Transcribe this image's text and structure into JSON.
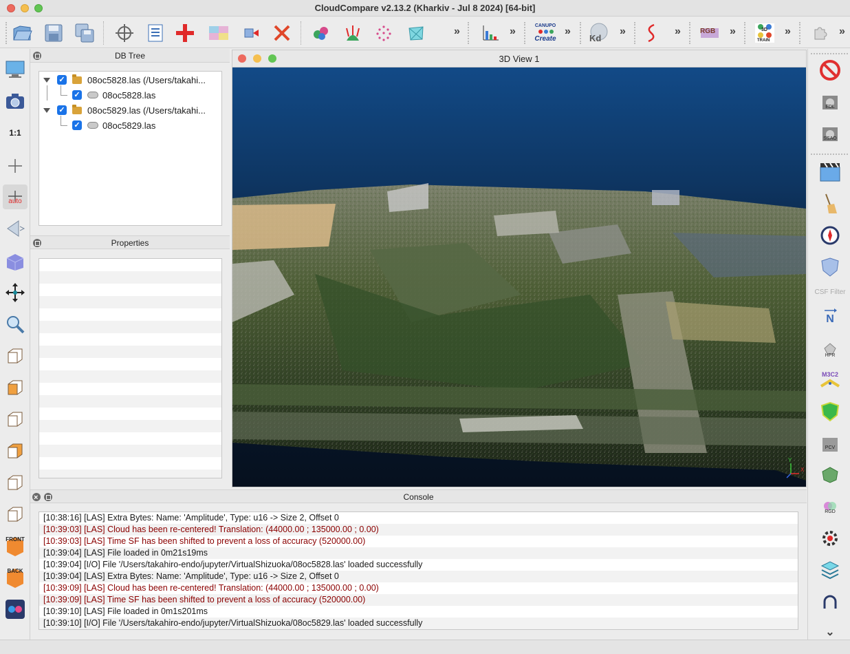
{
  "window": {
    "title": "CloudCompare v2.13.2 (Kharkiv - Jul  8 2024) [64-bit]"
  },
  "toolbar": {
    "icons": [
      "open-icon",
      "save-icon",
      "save-all-icon",
      "point-picking-icon",
      "list-icon",
      "add-cross-icon",
      "color-image-icon",
      "segment-icon",
      "delete-icon",
      "merge-icon",
      "normals-icon",
      "sample-icon",
      "mesh-icon",
      "histogram-icon",
      "canupo-create-icon",
      "kd-tree-icon",
      "curve-icon",
      "rgb-icon",
      "train-3d-icon",
      "plugin-icon"
    ],
    "canupo_top": "CANUPO",
    "canupo_bottom": "Create",
    "kd_label": "Kd",
    "rgb_label": "RGB",
    "train_label": "TRAIN",
    "train_3d": "3D"
  },
  "left_toolbar": {
    "one_to_one": "1:1",
    "auto_label": "auto",
    "front_label": "FRONT",
    "back_label": "BACK"
  },
  "right_toolbar": {
    "edl_label": "EDL",
    "ssao_label": "SSAO",
    "csf_label": "CSF Filter",
    "n_label": "N",
    "hpr_label": "HPR",
    "m3c2_label": "M3C2",
    "pcv_label": "PCV",
    "rgd_label": "RGD"
  },
  "db_tree": {
    "title": "DB Tree",
    "items": [
      {
        "label": "08oc5828.las (/Users/takahi...",
        "level": 0
      },
      {
        "label": "08oc5828.las",
        "level": 1
      },
      {
        "label": "08oc5829.las (/Users/takahi...",
        "level": 0
      },
      {
        "label": "08oc5829.las",
        "level": 1
      }
    ]
  },
  "properties": {
    "title": "Properties"
  },
  "view3d": {
    "title": "3D View 1",
    "axis_x": "X",
    "axis_y": "Y"
  },
  "console": {
    "title": "Console",
    "lines": [
      {
        "text": "[10:38:16] [LAS] Extra Bytes: Name: 'Amplitude', Type: u16 -> Size 2, Offset 0",
        "level": "info"
      },
      {
        "text": "[10:39:03] [LAS] Cloud has been re-centered! Translation: (44000.00 ; 135000.00 ; 0.00)",
        "level": "warn"
      },
      {
        "text": "[10:39:03] [LAS] Time SF has been shifted to prevent a loss of accuracy (520000.00)",
        "level": "warn"
      },
      {
        "text": "[10:39:04] [LAS] File loaded in 0m21s19ms",
        "level": "info"
      },
      {
        "text": "[10:39:04] [I/O] File '/Users/takahiro-endo/jupyter/VirtualShizuoka/08oc5828.las' loaded successfully",
        "level": "info"
      },
      {
        "text": "[10:39:04] [LAS] Extra Bytes: Name: 'Amplitude', Type: u16 -> Size 2, Offset 0",
        "level": "info"
      },
      {
        "text": "[10:39:09] [LAS] Cloud has been re-centered! Translation: (44000.00 ; 135000.00 ; 0.00)",
        "level": "warn"
      },
      {
        "text": "[10:39:09] [LAS] Time SF has been shifted to prevent a loss of accuracy (520000.00)",
        "level": "warn"
      },
      {
        "text": "[10:39:10] [LAS] File loaded in 0m1s201ms",
        "level": "info"
      },
      {
        "text": "[10:39:10] [I/O] File '/Users/takahiro-endo/jupyter/VirtualShizuoka/08oc5829.las' loaded successfully",
        "level": "info"
      }
    ]
  },
  "colors": {
    "checkbox": "#1a73e8",
    "warn_text": "#8b0000",
    "sky_top": "#124a87"
  }
}
